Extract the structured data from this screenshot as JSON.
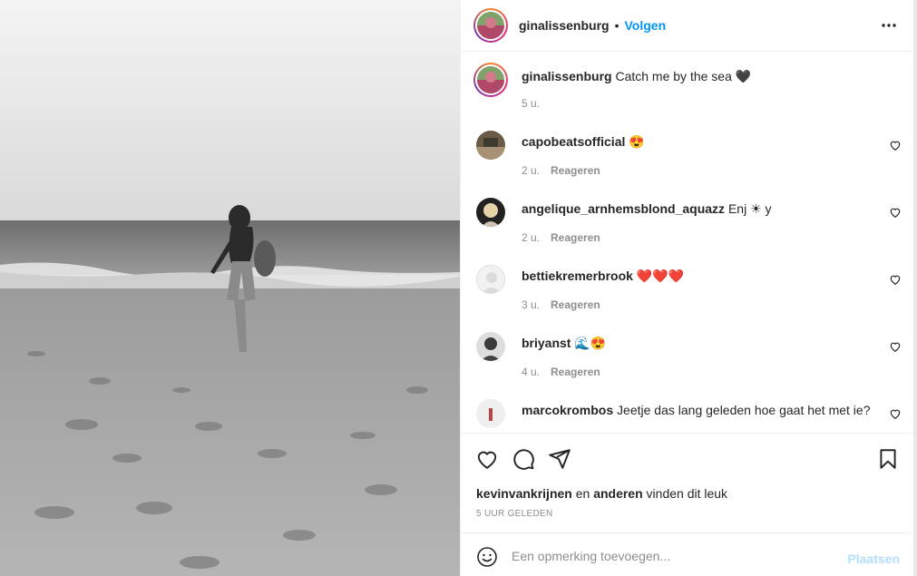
{
  "post": {
    "author": "ginalissenburg",
    "dot": "•",
    "follow_label": "Volgen",
    "more_label": "⋯",
    "caption_user": "ginalissenburg",
    "caption_text": "Catch me by the sea 🖤",
    "caption_time": "5 u."
  },
  "comments": [
    {
      "user": "capobeatsofficial",
      "text": "😍",
      "time": "2 u.",
      "reply": "Reageren"
    },
    {
      "user": "angelique_arnhemsblond_aquazz",
      "text": "Enj ☀︎ y",
      "time": "2 u.",
      "reply": "Reageren"
    },
    {
      "user": "bettiekremerbrook",
      "text": "❤️❤️❤️",
      "time": "3 u.",
      "reply": "Reageren"
    },
    {
      "user": "briyanst",
      "text": "🌊😍",
      "time": "4 u.",
      "reply": "Reageren"
    },
    {
      "user": "marcokrombos",
      "text": "Jeetje das lang geleden hoe gaat het met ie?",
      "time": "",
      "reply": ""
    }
  ],
  "likes": {
    "user": "kevinvankrijnen",
    "mid": "en",
    "others": "anderen",
    "suffix": "vinden dit leuk"
  },
  "time_ago": "5 UUR GELEDEN",
  "add_comment": {
    "placeholder": "Een opmerking toevoegen...",
    "post_label": "Plaatsen"
  },
  "colors": {
    "accent": "#0095f6",
    "post_disabled": "#b2dffc",
    "muted": "#8e8e8e"
  }
}
